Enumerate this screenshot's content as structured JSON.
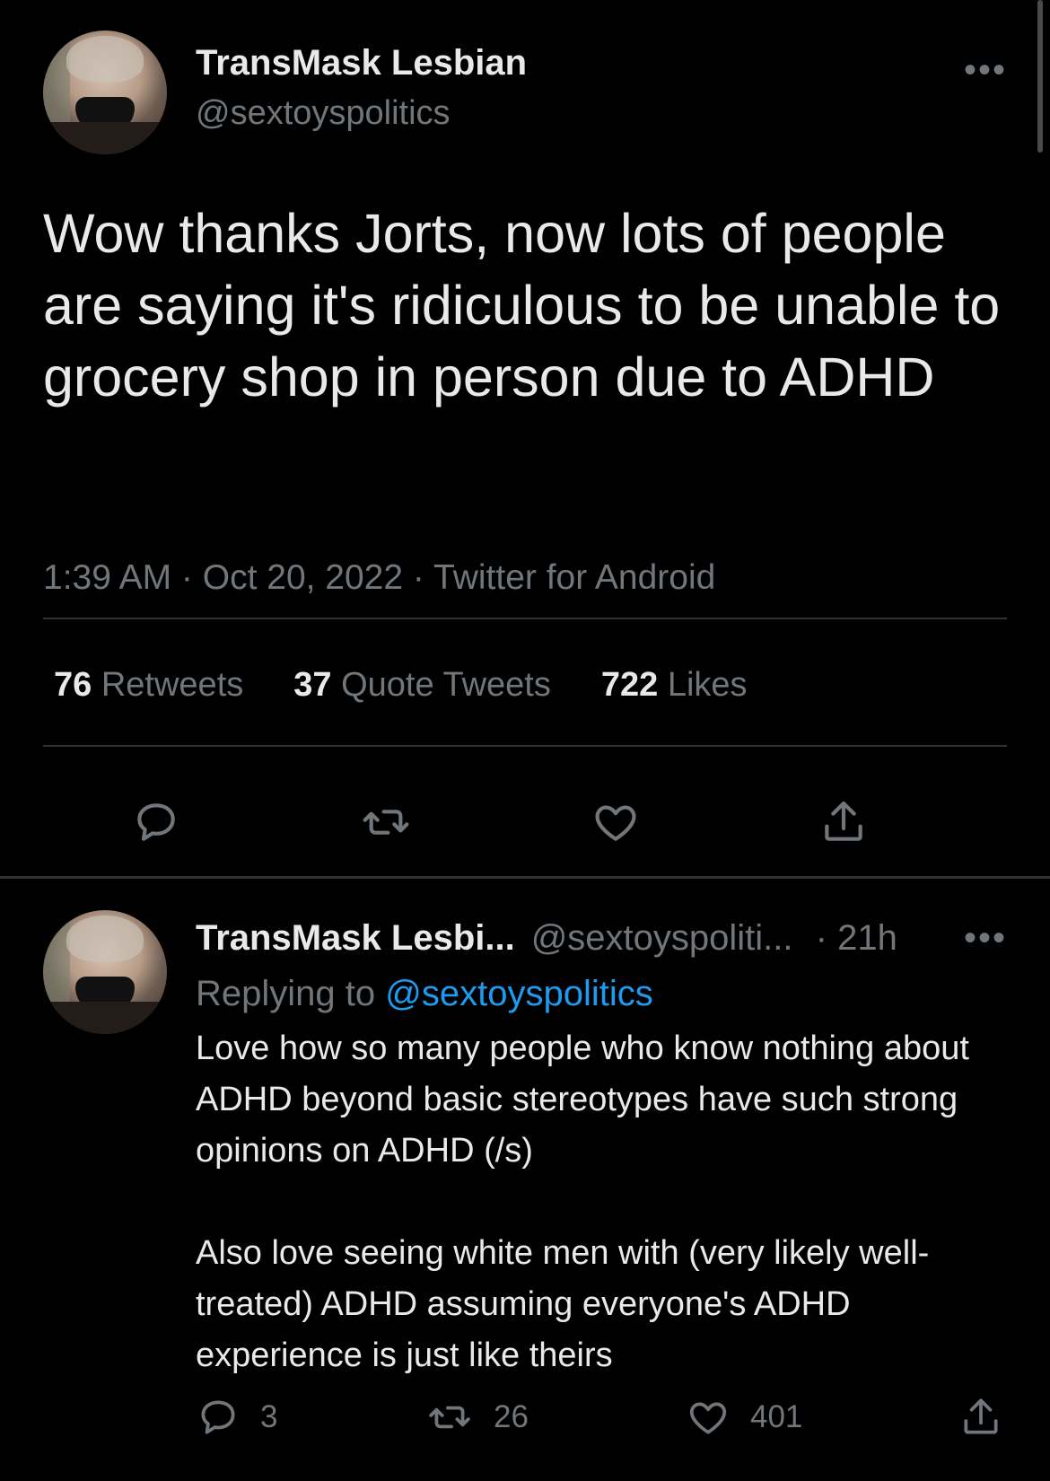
{
  "main_tweet": {
    "display_name": "TransMask Lesbian",
    "handle": "@sextoyspolitics",
    "more_icon": "more-horizontal-icon",
    "text": "Wow thanks Jorts, now lots of people are saying it's ridiculous to be unable to grocery shop in person due to ADHD",
    "meta": "1:39 AM · Oct 20, 2022 · Twitter for Android",
    "stats": {
      "retweets_count": "76",
      "retweets_label": "Retweets",
      "quotes_count": "37",
      "quotes_label": "Quote Tweets",
      "likes_count": "722",
      "likes_label": "Likes"
    }
  },
  "reply": {
    "display_name": "TransMask Lesbi...",
    "handle": "@sextoyspoliti...",
    "time": "· 21h",
    "replying_prefix": "Replying to",
    "replying_to": "@sextoyspolitics",
    "paragraph1": "Love how so many people who know nothing about ADHD beyond basic stereotypes have such strong opinions on ADHD (/s)",
    "paragraph2": "Also love seeing white men with (very likely well-treated) ADHD assuming everyone's ADHD experience is just like theirs",
    "reply_count": "3",
    "retweet_count": "26",
    "like_count": "401"
  },
  "colors": {
    "background": "#000000",
    "text": "#e7e9ea",
    "secondary": "#71767b",
    "accent": "#1d9bf0",
    "divider": "#2f3336"
  }
}
